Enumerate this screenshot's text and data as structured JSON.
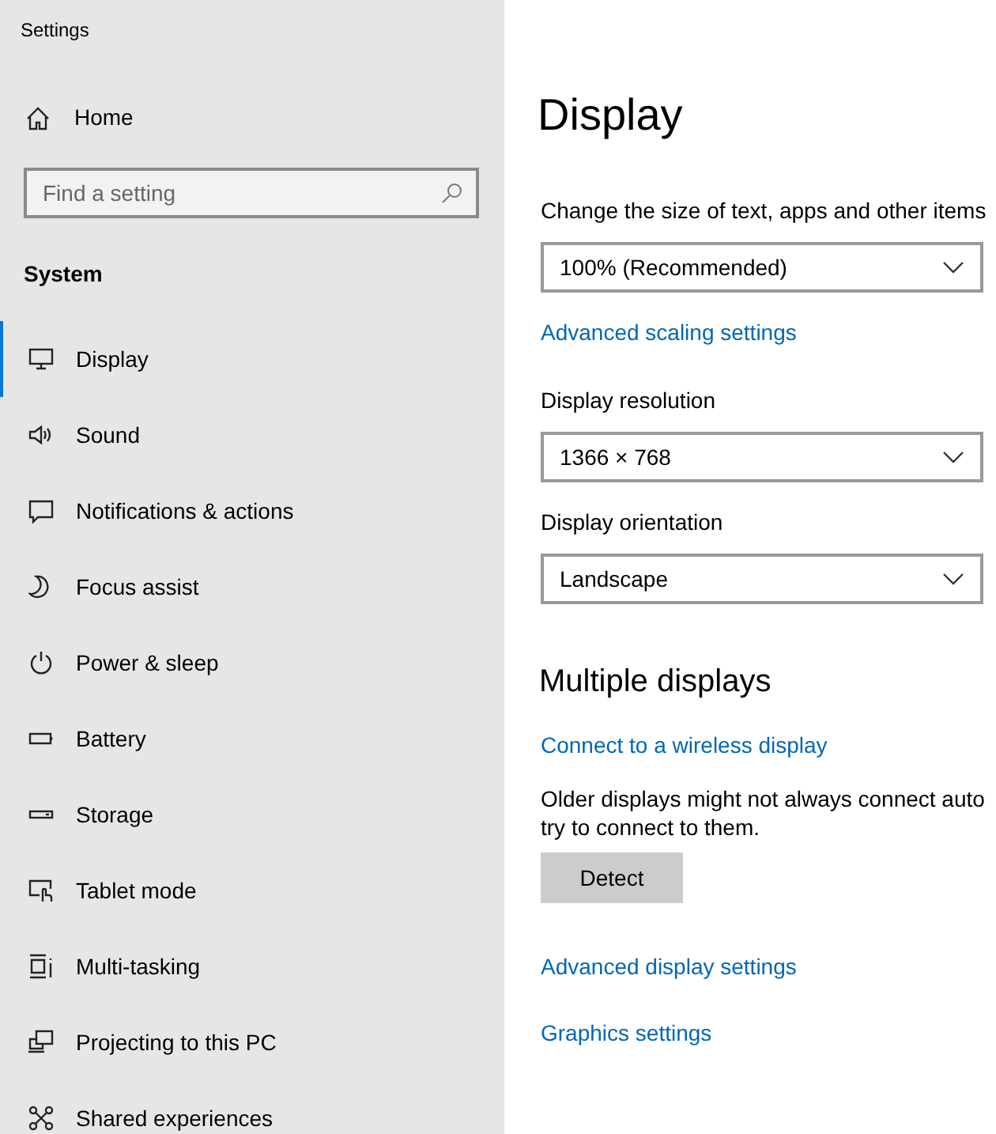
{
  "window": {
    "title": "Settings"
  },
  "sidebar": {
    "home": {
      "label": "Home"
    },
    "search": {
      "placeholder": "Find a setting"
    },
    "section": "System",
    "items": [
      {
        "label": "Display",
        "kind": "display",
        "selected": true
      },
      {
        "label": "Sound",
        "kind": "sound",
        "selected": false
      },
      {
        "label": "Notifications & actions",
        "kind": "notifications",
        "selected": false
      },
      {
        "label": "Focus assist",
        "kind": "focus",
        "selected": false
      },
      {
        "label": "Power & sleep",
        "kind": "power",
        "selected": false
      },
      {
        "label": "Battery",
        "kind": "battery",
        "selected": false
      },
      {
        "label": "Storage",
        "kind": "storage",
        "selected": false
      },
      {
        "label": "Tablet mode",
        "kind": "tablet",
        "selected": false
      },
      {
        "label": "Multi-tasking",
        "kind": "multitask",
        "selected": false
      },
      {
        "label": "Projecting to this PC",
        "kind": "project",
        "selected": false
      },
      {
        "label": "Shared experiences",
        "kind": "shared",
        "selected": false
      }
    ]
  },
  "page": {
    "title": "Display",
    "scale": {
      "label": "Change the size of text, apps and other items",
      "value": "100% (Recommended)"
    },
    "advanced_scaling_link": "Advanced scaling settings",
    "resolution": {
      "label": "Display resolution",
      "value": "1366 × 768"
    },
    "orientation": {
      "label": "Display orientation",
      "value": "Landscape"
    },
    "multiple": {
      "heading": "Multiple displays",
      "wireless_link": "Connect to a wireless display",
      "note_lines": [
        "Older displays might not always connect auto",
        "try to connect to them."
      ],
      "detect_button": "Detect"
    },
    "links": [
      "Advanced display settings",
      "Graphics settings"
    ]
  }
}
